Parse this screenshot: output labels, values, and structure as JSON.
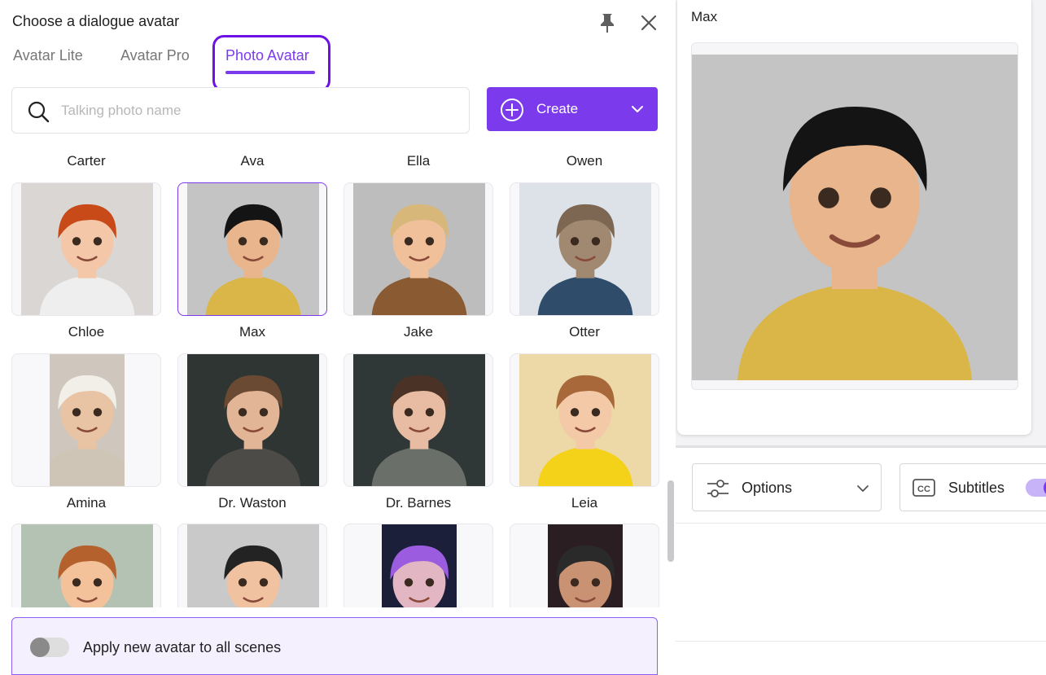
{
  "dialog": {
    "title": "Choose a dialogue avatar",
    "tabs": [
      {
        "label": "Avatar Lite"
      },
      {
        "label": "Avatar Pro"
      },
      {
        "label": "Photo Avatar"
      }
    ]
  },
  "search": {
    "placeholder": "Talking photo name",
    "value": ""
  },
  "create_button": {
    "label": "Create"
  },
  "top_labels": [
    "Carter",
    "Ava",
    "Ella",
    "Owen"
  ],
  "avatars_row1": [
    {
      "name": "Chloe",
      "bg": "#d9d6d3",
      "skin": "#f3c7a8",
      "hair": "#c74a18",
      "shirt": "#eeeeee"
    },
    {
      "name": "Max",
      "bg": "#c4c4c4",
      "skin": "#e9b58c",
      "hair": "#141414",
      "shirt": "#d9b647"
    },
    {
      "name": "Jake",
      "bg": "#bdbdbd",
      "skin": "#f0c09a",
      "hair": "#d8b77a",
      "shirt": "#8a5a32"
    },
    {
      "name": "Otter",
      "bg": "#dde2e8",
      "skin": "#a08970",
      "hair": "#7d6652",
      "shirt": "#2f4d6a"
    }
  ],
  "avatars_row2": [
    {
      "name": "Amina",
      "bg": "#cfc7bd",
      "skin": "#e8c3a4",
      "hair": "#f2efe8",
      "shirt": "#cfc5b6"
    },
    {
      "name": "Dr. Waston",
      "bg": "#2e3533",
      "skin": "#e2b596",
      "hair": "#6b4a34",
      "shirt": "#4d4b47"
    },
    {
      "name": "Dr. Barnes",
      "bg": "#2f3836",
      "skin": "#e7bca2",
      "hair": "#4a3226",
      "shirt": "#6a7069"
    },
    {
      "name": "Leia",
      "bg": "#ecd9a7",
      "skin": "#f3c9a8",
      "hair": "#a8683a",
      "shirt": "#f5d21a"
    }
  ],
  "avatars_row3": [
    {
      "name": "",
      "bg": "#b4c2b4",
      "skin": "#f4c29a",
      "hair": "#b4612e",
      "shirt": "#7a8e7a"
    },
    {
      "name": "",
      "bg": "#c9c9c9",
      "skin": "#f0c2a0",
      "hair": "#232323",
      "shirt": "#cfcfcf"
    },
    {
      "name": "",
      "bg": "#1b1f3a",
      "skin": "#e3b6c4",
      "hair": "#9b5ce0",
      "shirt": "#2a2040"
    },
    {
      "name": "",
      "bg": "#2a1e22",
      "skin": "#c89273",
      "hair": "#2a2a2a",
      "shirt": "#1c1c1c"
    }
  ],
  "apply": {
    "label": "Apply new avatar to all scenes",
    "enabled": false
  },
  "preview": {
    "name": "Max"
  },
  "options": {
    "label": "Options"
  },
  "subtitles": {
    "label": "Subtitles",
    "enabled": true
  },
  "colors": {
    "accent": "#7c3aed"
  }
}
